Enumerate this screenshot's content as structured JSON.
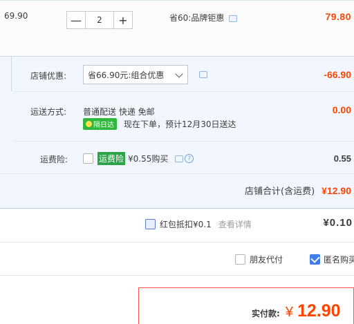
{
  "item": {
    "price": "69.90",
    "quantity": "2",
    "qty_minus": "—",
    "qty_plus": "+",
    "promo": "省60:品牌钜惠",
    "subtotal": "79.80"
  },
  "shop_discount": {
    "label": "店铺优惠:",
    "selected": "省66.90元:组合优惠",
    "amount": "-66.90"
  },
  "shipping": {
    "label": "运送方式:",
    "method": "普通配送 快递 免邮",
    "badge": "隔日达",
    "note": "现在下单，预计12月30日送达",
    "amount": "0.00"
  },
  "insurance": {
    "label": "运费险:",
    "tag": "运费险",
    "price_text": "¥0.55购买",
    "amount": "0.55"
  },
  "shop_total": {
    "label": "店铺合计(含运费)",
    "amount": "¥12.90"
  },
  "red_packet": {
    "label": "红包抵扣¥0.1",
    "link": "查看详情",
    "amount": "¥0.10"
  },
  "options": {
    "friend_pay": "朋友代付",
    "anonymous": "匿名购买"
  },
  "payment": {
    "label": "实付款:",
    "currency": "¥",
    "amount": "12.90"
  },
  "colors": {
    "accent_red": "#ff4400",
    "section_bg": "#f2f7ff",
    "check_blue": "#3f7ee8",
    "green": "#2fb83c"
  }
}
